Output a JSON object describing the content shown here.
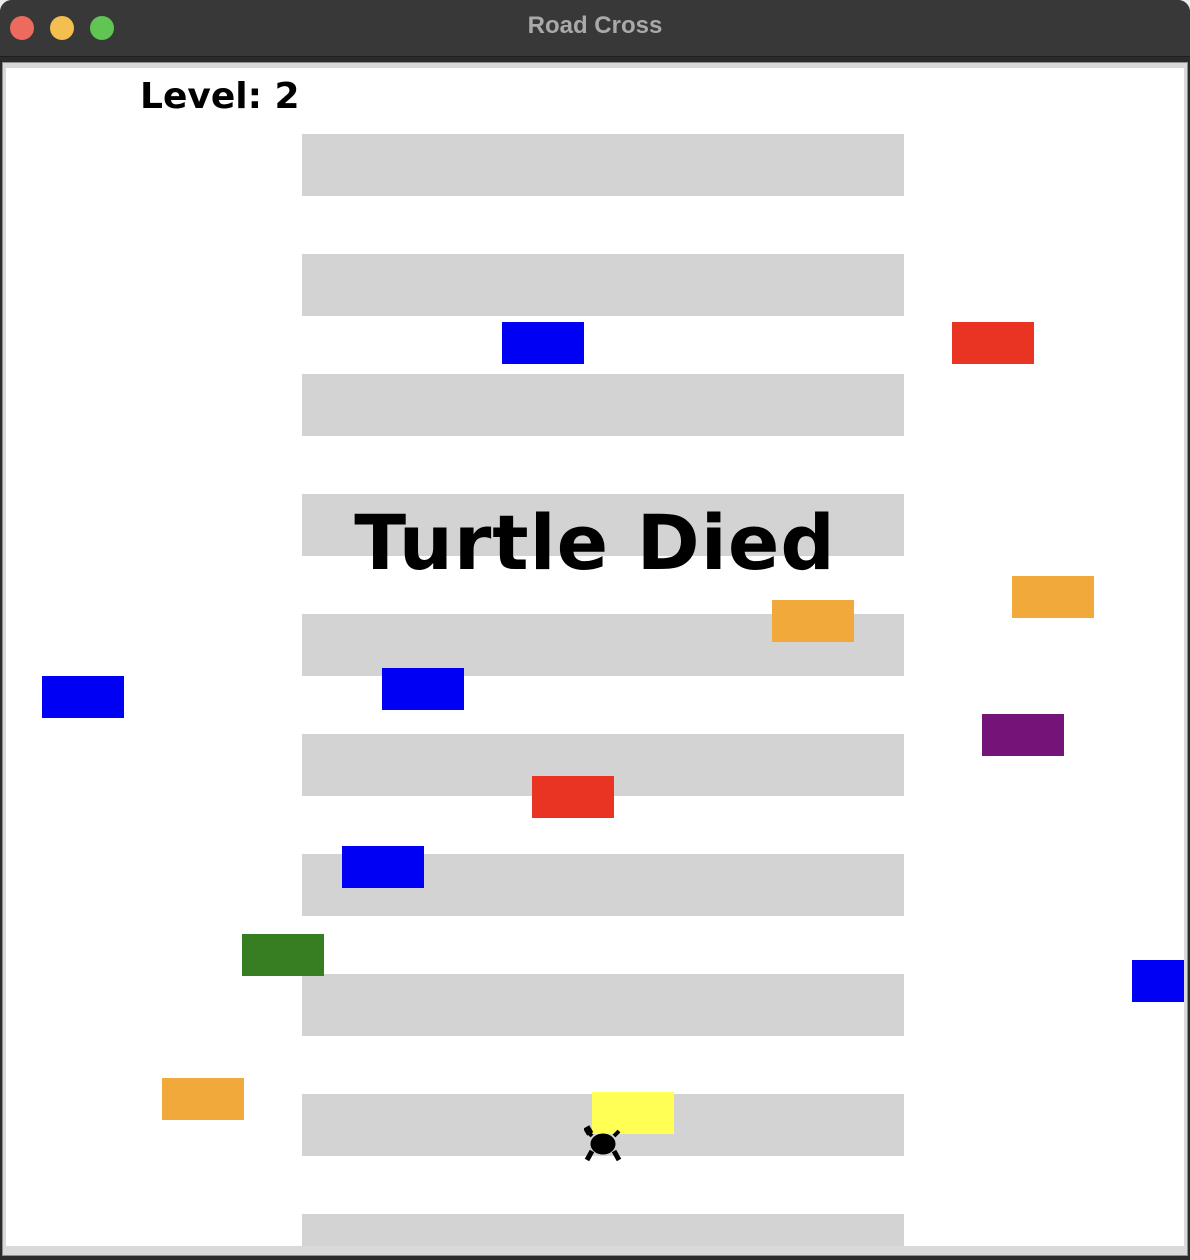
{
  "window": {
    "title": "Road Cross"
  },
  "hud": {
    "level_label": "Level: 2"
  },
  "message": {
    "text": "Turtle Died"
  },
  "colors": {
    "road_stripe": "#d3d3d3",
    "blue": "#0000f5",
    "red": "#e93323",
    "orange": "#f2a93b",
    "purple": "#741378",
    "green": "#377d22",
    "yellow": "#ffff54",
    "turtle": "#000000"
  },
  "cars": [
    {
      "color": "blue"
    },
    {
      "color": "red"
    },
    {
      "color": "orange"
    },
    {
      "color": "orange"
    },
    {
      "color": "blue"
    },
    {
      "color": "blue"
    },
    {
      "color": "purple"
    },
    {
      "color": "red"
    },
    {
      "color": "blue"
    },
    {
      "color": "green"
    },
    {
      "color": "blue"
    },
    {
      "color": "orange"
    },
    {
      "color": "yellow"
    }
  ],
  "player": {
    "icon": "turtle-icon"
  }
}
